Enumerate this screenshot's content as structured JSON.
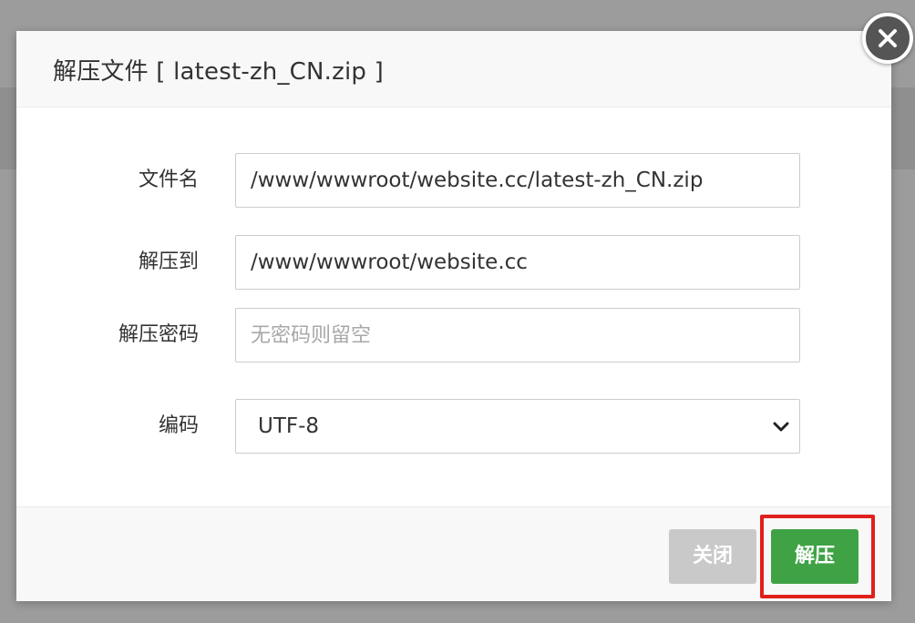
{
  "dialog": {
    "title": "解压文件 [ latest-zh_CN.zip ]",
    "close_icon": "close-icon"
  },
  "form": {
    "filename": {
      "label": "文件名",
      "value": "/www/wwwroot/website.cc/latest-zh_CN.zip"
    },
    "extract_to": {
      "label": "解压到",
      "value": "/www/wwwroot/website.cc"
    },
    "password": {
      "label": "解压密码",
      "value": "",
      "placeholder": "无密码则留空"
    },
    "encoding": {
      "label": "编码",
      "value": "UTF-8",
      "icon": "chevron-down-icon"
    }
  },
  "footer": {
    "cancel_label": "关闭",
    "extract_label": "解压"
  },
  "colors": {
    "primary": "#3fa345",
    "cancel": "#c9c9c9",
    "highlight": "#e0201c"
  }
}
